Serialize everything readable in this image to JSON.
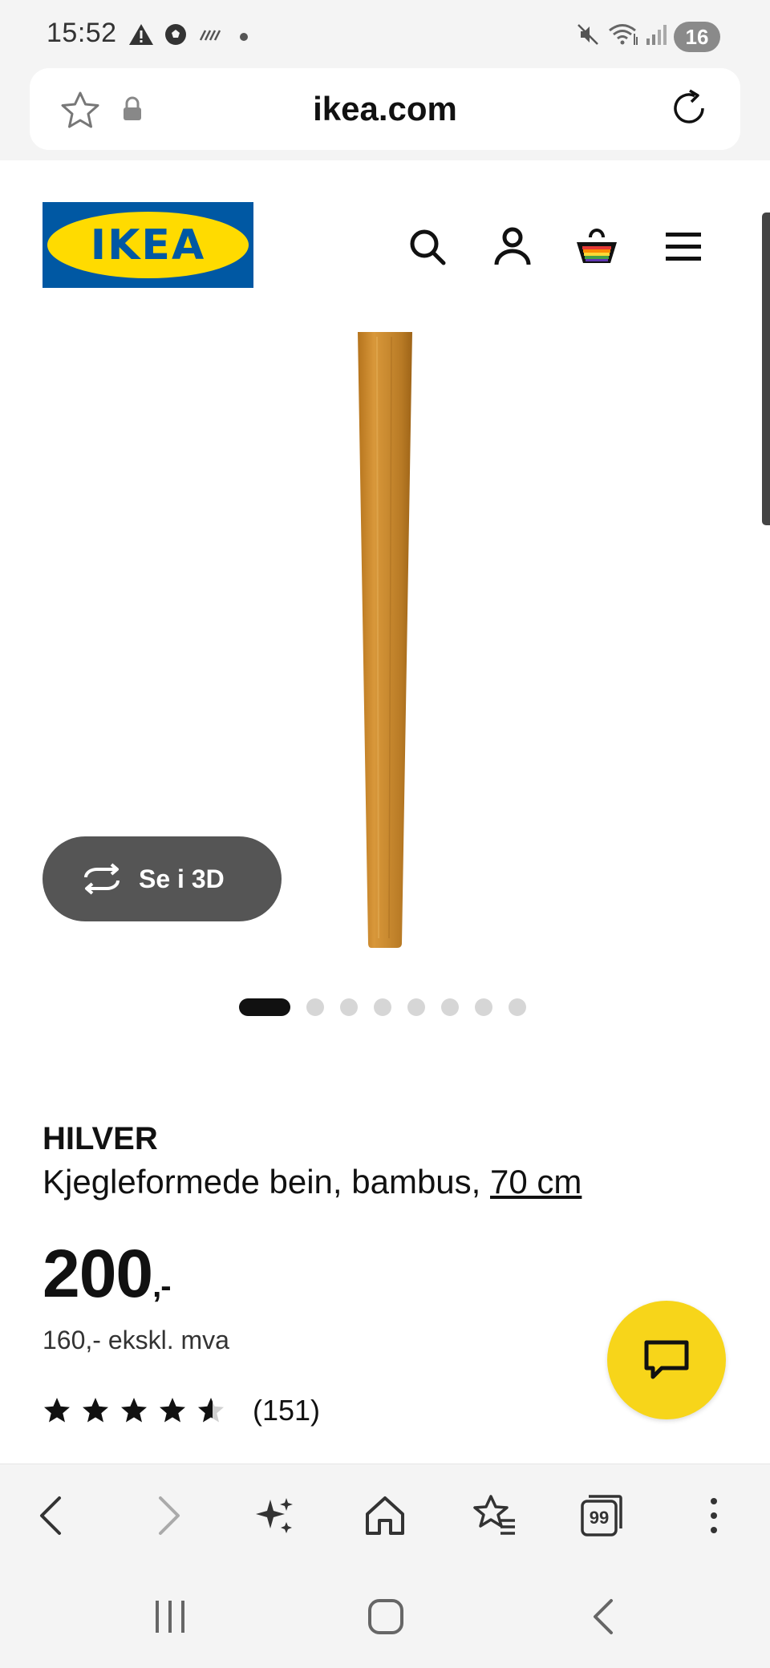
{
  "status_bar": {
    "time": "15:52",
    "battery": "16",
    "left_icons": [
      "warning-icon",
      "soccer-ball-icon",
      "data-saver-icon",
      "dot-icon"
    ],
    "right_icons": [
      "mute-icon",
      "wifi-icon",
      "signal-icon"
    ]
  },
  "browser": {
    "url": "ikea.com",
    "icons": [
      "bookmark-star-icon",
      "lock-icon",
      "reload-icon"
    ]
  },
  "header": {
    "logo_text": "IKEA",
    "icons": [
      "search-icon",
      "account-icon",
      "basket-icon",
      "menu-icon"
    ]
  },
  "gallery": {
    "view_3d_label": "Se i 3D",
    "total_images": 8,
    "active_index": 0
  },
  "product": {
    "name": "HILVER",
    "description": "Kjegleformede bein, bambus,",
    "size_link": "70 cm",
    "price": "200",
    "price_suffix": ",-",
    "price_ex_vat": "160,- ekskl. mva",
    "rating": 4.5,
    "rating_max": 5,
    "review_count": "(151)"
  },
  "colors": {
    "ikea_blue": "#0058a3",
    "ikea_yellow": "#ffdb00",
    "chat_yellow": "#f7d51a",
    "bamboo": "#c78a2e"
  },
  "toolbar": {
    "icons": [
      "back-icon",
      "forward-icon",
      "ai-sparkle-icon",
      "home-icon",
      "bookmarks-icon",
      "tabs-icon",
      "more-icon"
    ],
    "tabs_count": "99"
  }
}
